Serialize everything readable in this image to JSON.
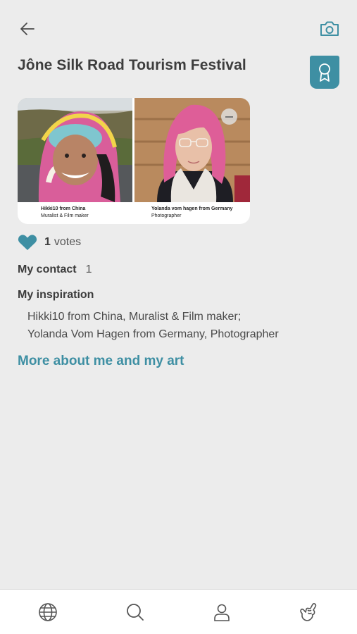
{
  "header": {
    "back_icon": "arrow-left-icon",
    "camera_icon": "camera-icon",
    "title": "Jône Silk Road Tourism Festival",
    "badge_icon": "award-ribbon-icon",
    "accent_color": "#3e8fa3"
  },
  "gallery": {
    "photos": [
      {
        "name": "Hikki10 from China",
        "role": "Muralist & Film maker"
      },
      {
        "name": "Yolanda vom hagen from Germany",
        "role": "Photographer"
      }
    ],
    "remove_icon": "minus-circle-icon"
  },
  "votes": {
    "icon": "heart-icon",
    "count": "1",
    "label": "votes"
  },
  "contact": {
    "label": "My contact",
    "value": "1"
  },
  "inspiration": {
    "heading": "My inspiration",
    "lines": [
      "Hikki10 from China, Muralist & Film maker;",
      "Yolanda Vom Hagen from Germany, Photographer"
    ]
  },
  "more_link": "More about me and my art",
  "bottom_nav": [
    {
      "icon": "globe-icon"
    },
    {
      "icon": "search-icon"
    },
    {
      "icon": "user-icon"
    },
    {
      "icon": "shaka-hand-icon"
    }
  ]
}
